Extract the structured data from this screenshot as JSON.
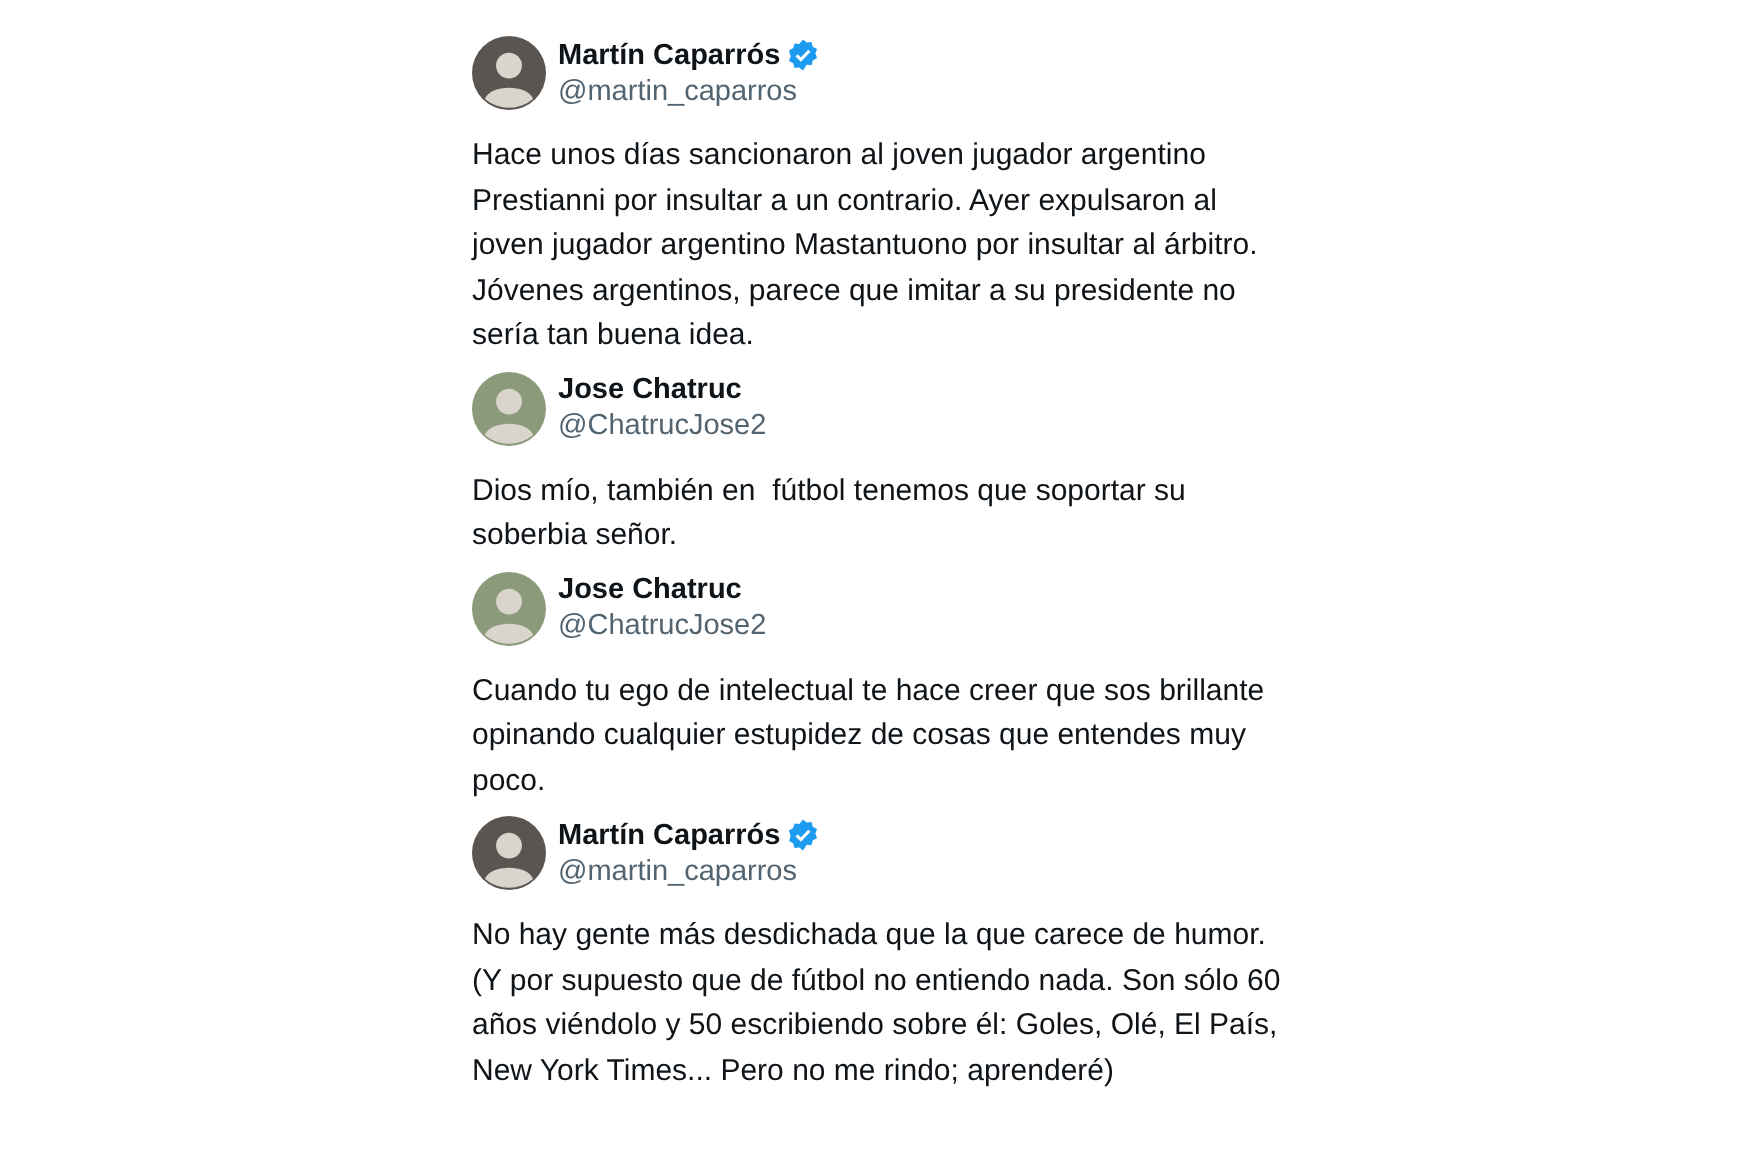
{
  "tweets": [
    {
      "name": "Martín Caparrós",
      "verified": true,
      "handle": "@martin_caparros",
      "text": "Hace unos días sancionaron al joven jugador argentino Prestianni por insultar a un contrario. Ayer expulsaron al joven jugador argentino Mastantuono por insultar al árbitro.\nJóvenes argentinos, parece que imitar a su presidente no sería tan buena idea."
    },
    {
      "name": "Jose Chatruc",
      "verified": false,
      "handle": "@ChatrucJose2",
      "text": "Dios mío, también en  fútbol tenemos que soportar su soberbia señor."
    },
    {
      "name": "Jose Chatruc",
      "verified": false,
      "handle": "@ChatrucJose2",
      "text": "Cuando tu ego de intelectual te hace creer que sos brillante opinando cualquier estupidez de cosas que entendes muy poco."
    },
    {
      "name": "Martín Caparrós",
      "verified": true,
      "handle": "@martin_caparros",
      "text": "No hay gente más desdichada que la que carece de humor.\n(Y por supuesto que de fútbol no entiendo nada. Son sólo 60 años viéndolo y 50 escribiendo sobre él: Goles, Olé, El País, New York Times... Pero no me rindo; aprenderé)"
    }
  ]
}
